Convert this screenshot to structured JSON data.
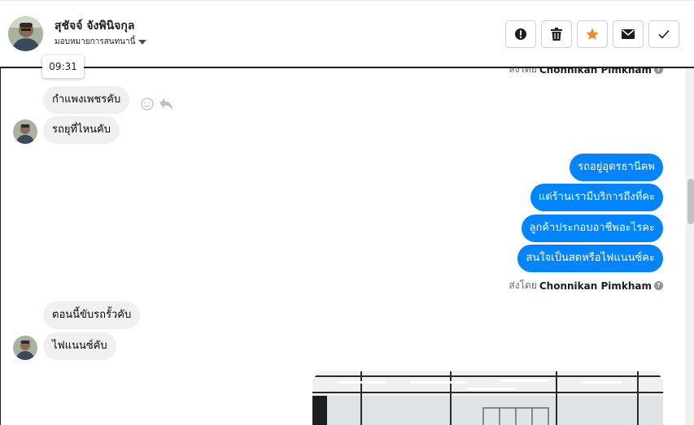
{
  "header": {
    "contact_name": "สุชัจจ์ จังพินิจกุล",
    "assign_label": "มอบหมายการสนทนานี้"
  },
  "actions": [
    {
      "icon": "alert-icon",
      "color": "#1c1e21"
    },
    {
      "icon": "trash-icon",
      "color": "#1c1e21"
    },
    {
      "icon": "star-icon",
      "color": "#f5892a"
    },
    {
      "icon": "mail-icon",
      "color": "#1c1e21"
    },
    {
      "icon": "check-icon",
      "color": "#1c1e21"
    }
  ],
  "tooltip": {
    "time": "09:31"
  },
  "sent_by": {
    "prefix": "ส่งโดย",
    "name": "Chonnikan Pimkham"
  },
  "messages": {
    "incoming_1": "กำแพงเพชรคับ",
    "incoming_2": "รถยุที่ไหนคับ",
    "outgoing": [
      "รถอยู่อุดรธานีคพ",
      "แต่ร้านเรามีบริการถึงที่คะ",
      "ลูกค้าประกอบอาชีพอะไรคะ",
      "สนใจเป็นสดหรือไฟแนนซ์คะ"
    ],
    "incoming_3": "ตอนนี้ขับรถรั้วคับ",
    "incoming_4": "ไฟแนนซ์คับ"
  },
  "colors": {
    "outgoing_bubble": "#0084ff",
    "incoming_bubble": "#f0f0f0",
    "star": "#f5892a"
  }
}
